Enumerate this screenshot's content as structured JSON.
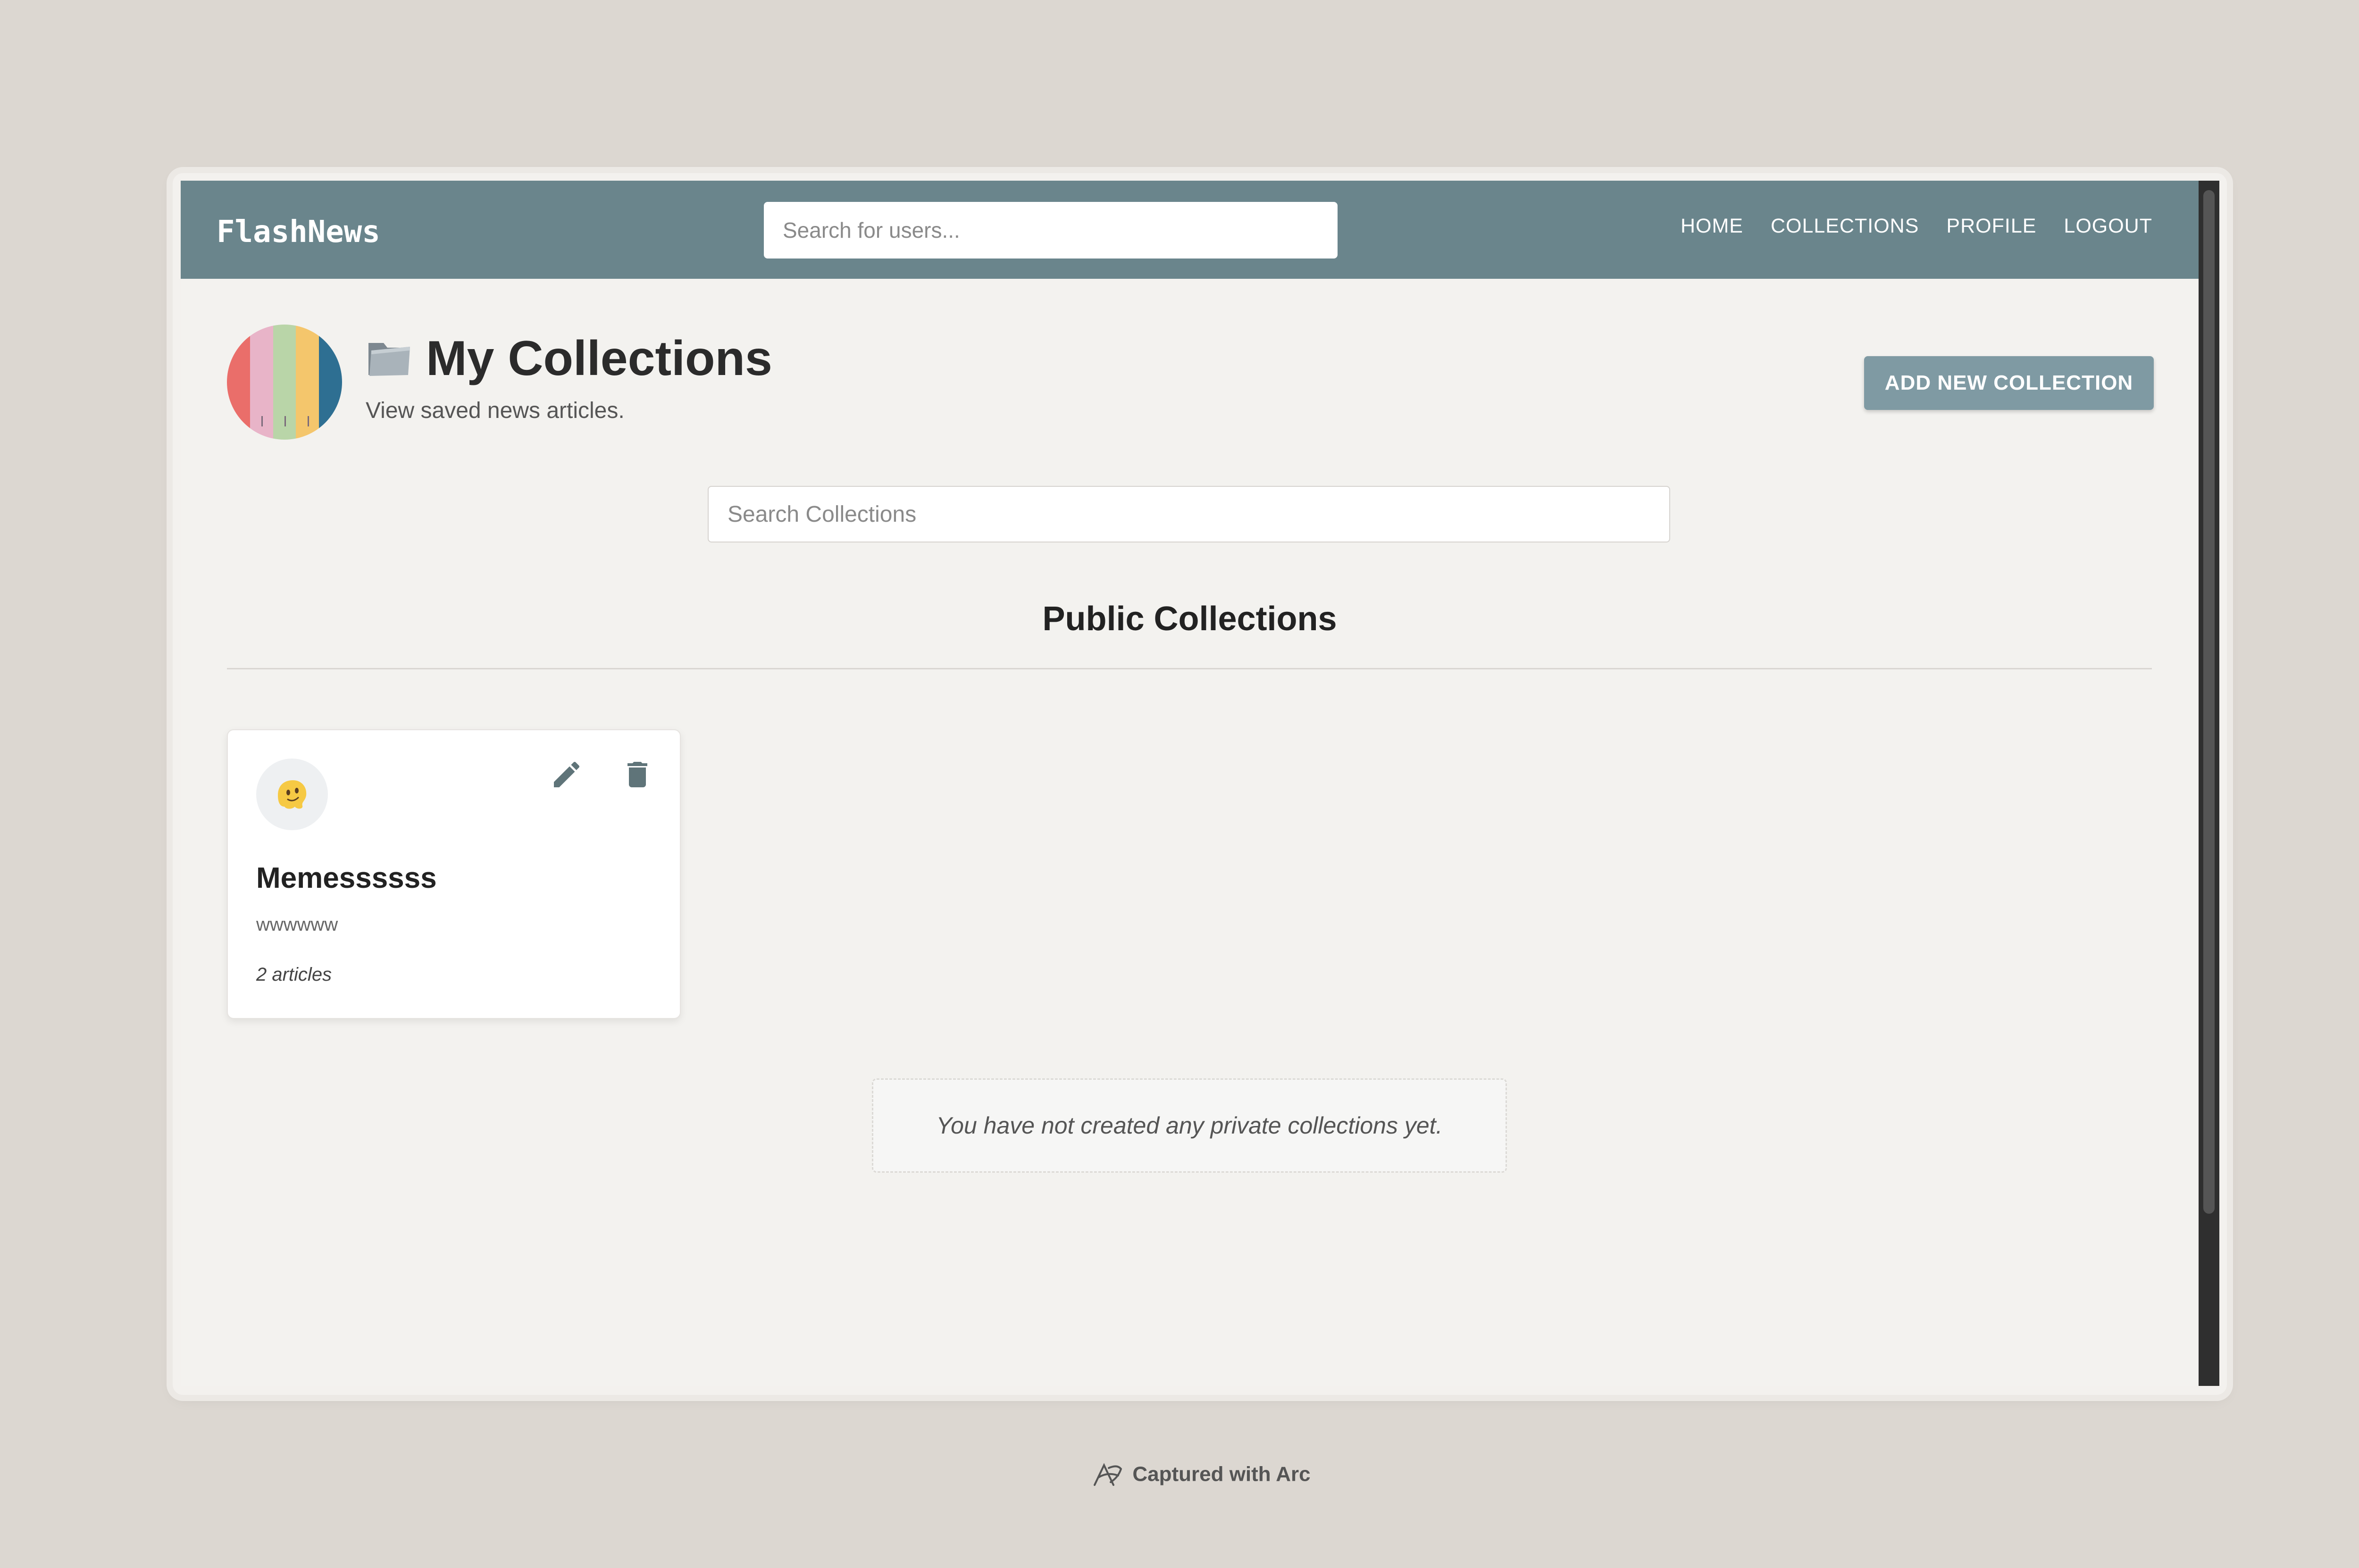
{
  "navbar": {
    "brand": "FlashNews",
    "search_placeholder": "Search for users...",
    "links": [
      "HOME",
      "COLLECTIONS",
      "PROFILE",
      "LOGOUT"
    ]
  },
  "header": {
    "title": "My Collections",
    "subtitle": "View saved news articles.",
    "add_button_label": "ADD NEW COLLECTION",
    "avatar_colors": [
      "#ea6e6a",
      "#e8b4c8",
      "#b9d5a8",
      "#f4c66c",
      "#2e6f92"
    ]
  },
  "collection_search": {
    "placeholder": "Search Collections"
  },
  "public_section": {
    "title": "Public Collections",
    "cards": [
      {
        "emoji": "🫠",
        "title": "Memessssss",
        "description": "wwwwww",
        "count": "2 articles"
      }
    ]
  },
  "private_section": {
    "empty_message": "You have not created any private collections yet."
  },
  "footer": {
    "captured": "Captured with Arc"
  },
  "colors": {
    "navbar": "#6a858c",
    "add_button": "#7f9aa3",
    "icon": "#5f7479"
  }
}
